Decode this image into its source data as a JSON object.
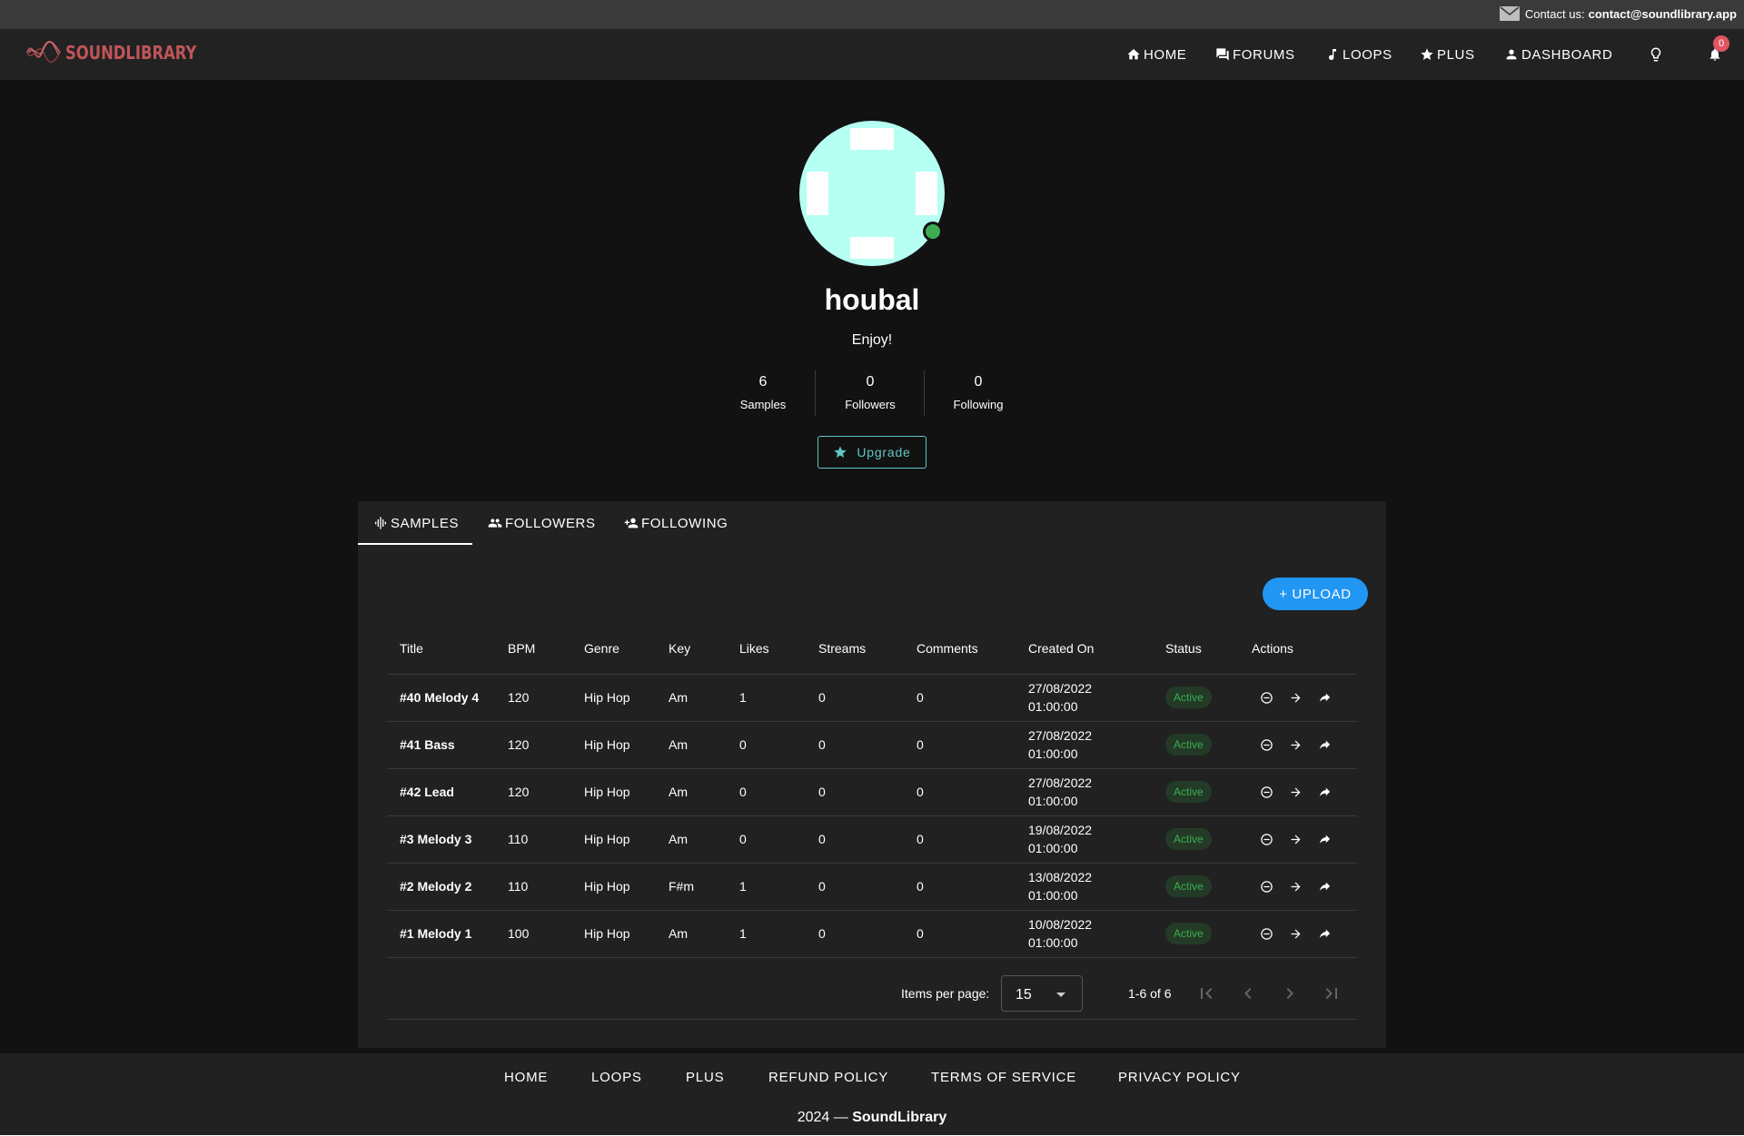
{
  "topbar": {
    "contact_label": "Contact us:",
    "contact_email": "contact@soundlibrary.app"
  },
  "nav": {
    "logo_text": "SOUNDLIBRARY",
    "items": [
      {
        "label": "HOME",
        "icon": "home-icon"
      },
      {
        "label": "FORUMS",
        "icon": "forum-icon"
      },
      {
        "label": "LOOPS",
        "icon": "music-note-icon"
      },
      {
        "label": "PLUS",
        "icon": "star-icon"
      },
      {
        "label": "DASHBOARD",
        "icon": "person-icon"
      }
    ],
    "theme_icon": "lightbulb-icon",
    "notifications_count": "0"
  },
  "profile": {
    "username": "houbal",
    "bio": "Enjoy!",
    "stats": [
      {
        "value": "6",
        "label": "Samples"
      },
      {
        "value": "0",
        "label": "Followers"
      },
      {
        "value": "0",
        "label": "Following"
      }
    ],
    "upgrade_label": "Upgrade",
    "avatar_color": "#b6fff3",
    "online_color": "#3cae51"
  },
  "tabs": [
    {
      "label": "SAMPLES",
      "icon": "waveform-icon"
    },
    {
      "label": "FOLLOWERS",
      "icon": "group-icon"
    },
    {
      "label": "FOLLOWING",
      "icon": "person-add-icon"
    }
  ],
  "upload_label": "+ UPLOAD",
  "table": {
    "headers": [
      "Title",
      "BPM",
      "Genre",
      "Key",
      "Likes",
      "Streams",
      "Comments",
      "Created On",
      "Status",
      "Actions"
    ],
    "rows": [
      {
        "title": "#40 Melody 4",
        "bpm": "120",
        "genre": "Hip Hop",
        "key": "Am",
        "likes": "1",
        "streams": "0",
        "comments": "0",
        "date": "27/08/2022",
        "time": "01:00:00",
        "status": "Active"
      },
      {
        "title": "#41 Bass",
        "bpm": "120",
        "genre": "Hip Hop",
        "key": "Am",
        "likes": "0",
        "streams": "0",
        "comments": "0",
        "date": "27/08/2022",
        "time": "01:00:00",
        "status": "Active"
      },
      {
        "title": "#42 Lead",
        "bpm": "120",
        "genre": "Hip Hop",
        "key": "Am",
        "likes": "0",
        "streams": "0",
        "comments": "0",
        "date": "27/08/2022",
        "time": "01:00:00",
        "status": "Active"
      },
      {
        "title": "#3 Melody 3",
        "bpm": "110",
        "genre": "Hip Hop",
        "key": "Am",
        "likes": "0",
        "streams": "0",
        "comments": "0",
        "date": "19/08/2022",
        "time": "01:00:00",
        "status": "Active"
      },
      {
        "title": "#2 Melody 2",
        "bpm": "110",
        "genre": "Hip Hop",
        "key": "F#m",
        "likes": "1",
        "streams": "0",
        "comments": "0",
        "date": "13/08/2022",
        "time": "01:00:00",
        "status": "Active"
      },
      {
        "title": "#1 Melody 1",
        "bpm": "100",
        "genre": "Hip Hop",
        "key": "Am",
        "likes": "1",
        "streams": "0",
        "comments": "0",
        "date": "10/08/2022",
        "time": "01:00:00",
        "status": "Active"
      }
    ]
  },
  "pagination": {
    "items_per_page_label": "Items per page:",
    "items_per_page": "15",
    "range": "1-6 of 6"
  },
  "footer": {
    "links": [
      "HOME",
      "LOOPS",
      "PLUS",
      "REFUND POLICY",
      "TERMS OF SERVICE",
      "PRIVACY POLICY"
    ],
    "copyright_prefix": "2024 —",
    "copyright_brand": "SoundLibrary"
  }
}
